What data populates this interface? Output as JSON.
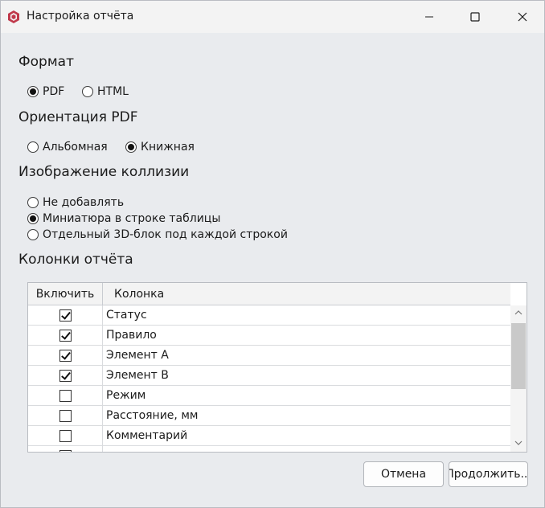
{
  "window": {
    "title": "Настройка отчёта",
    "app_icon": "cube-icon"
  },
  "format": {
    "title": "Формат",
    "options": [
      {
        "label": "PDF",
        "checked": true
      },
      {
        "label": "HTML",
        "checked": false
      }
    ]
  },
  "orientation": {
    "title": "Ориентация PDF",
    "options": [
      {
        "label": "Альбомная",
        "checked": false
      },
      {
        "label": "Книжная",
        "checked": true
      }
    ]
  },
  "collision_image": {
    "title": "Изображение коллизии",
    "options": [
      {
        "label": "Не добавлять",
        "checked": false
      },
      {
        "label": "Миниатюра в строке таблицы",
        "checked": true
      },
      {
        "label": "Отдельный 3D-блок под каждой строкой",
        "checked": false
      }
    ]
  },
  "columns": {
    "title": "Колонки отчёта",
    "header_include": "Включить",
    "header_column": "Колонка",
    "rows": [
      {
        "name": "Статус",
        "checked": true
      },
      {
        "name": "Правило",
        "checked": true
      },
      {
        "name": "Элемент А",
        "checked": true
      },
      {
        "name": "Элемент В",
        "checked": true
      },
      {
        "name": "Режим",
        "checked": false
      },
      {
        "name": "Расстояние, мм",
        "checked": false
      },
      {
        "name": "Комментарий",
        "checked": false
      },
      {
        "name": "",
        "checked": false
      }
    ]
  },
  "buttons": {
    "cancel": "Отмена",
    "continue": "Продолжить..."
  }
}
